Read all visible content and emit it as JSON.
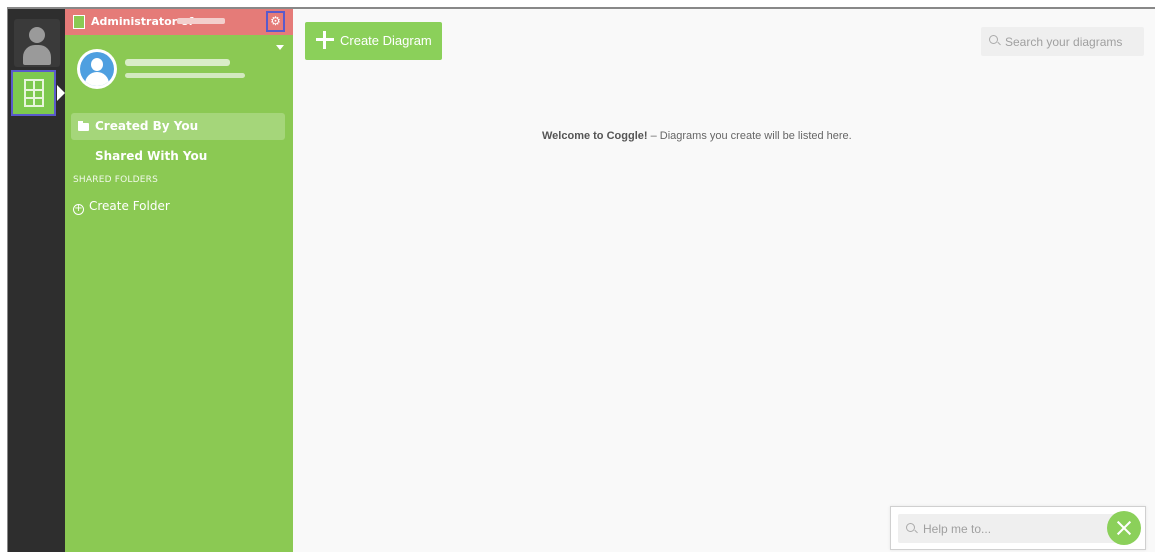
{
  "sidebar": {
    "header_title": "Administrator of",
    "nav": {
      "created_by_you": "Created By You",
      "shared_with_you": "Shared With You",
      "shared_folders_heading": "SHARED FOLDERS",
      "create_folder": "Create Folder"
    }
  },
  "main": {
    "create_button": "Create Diagram",
    "search_placeholder": "Search your diagrams",
    "welcome_bold": "Welcome to Coggle!",
    "welcome_rest": " – Diagrams you create will be listed here."
  },
  "help": {
    "placeholder": "Help me to..."
  },
  "colors": {
    "sidebar_green": "#8bc953",
    "header_red": "#e57b78",
    "accent_green": "#8bd05a",
    "rail_dark": "#2e2e2e",
    "highlight_blue": "#5a5acb"
  },
  "icons": [
    "user-icon",
    "diagram-grid-icon",
    "gear-icon",
    "dropdown-caret-icon",
    "avatar-icon",
    "folder-icon",
    "plus-circle-icon",
    "plus-icon",
    "search-icon",
    "close-icon"
  ]
}
